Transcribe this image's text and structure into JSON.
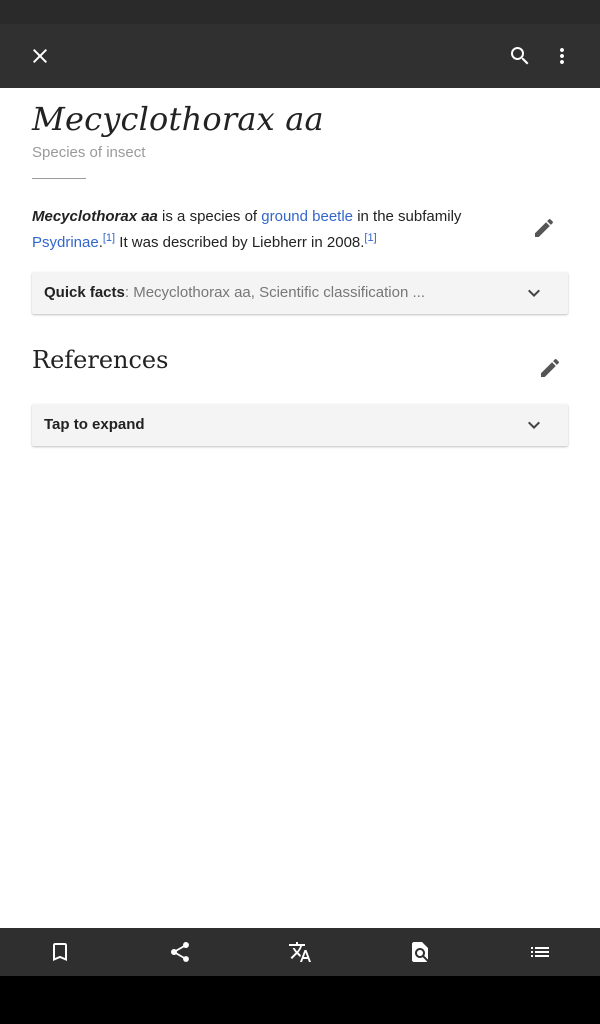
{
  "toolbar": {
    "close_icon": "close-icon",
    "search_icon": "search-icon",
    "more_icon": "more-vert-icon"
  },
  "article": {
    "title": "Mecyclothorax aa",
    "subtitle": "Species of insect",
    "lead": {
      "bold_name": "Mecyclothorax aa",
      "text1": " is a species of ",
      "link1": "ground beetle",
      "text2": " in the subfamily ",
      "link2": "Psydrinae",
      "text3": ".",
      "ref1": "[1]",
      "text4": " It was described by Liebherr in 2008.",
      "ref2": "[1]"
    }
  },
  "quick_facts": {
    "label": "Quick facts",
    "summary": ": Mecyclothorax aa, Scientific classification ..."
  },
  "references": {
    "title": "References",
    "expand_label": "Tap to expand"
  },
  "bottom_bar": {
    "icons": [
      "bookmark-icon",
      "share-icon",
      "translate-icon",
      "find-in-page-icon",
      "table-of-contents-icon"
    ]
  },
  "colors": {
    "toolbar_bg": "#303030",
    "link": "#3366cc"
  }
}
